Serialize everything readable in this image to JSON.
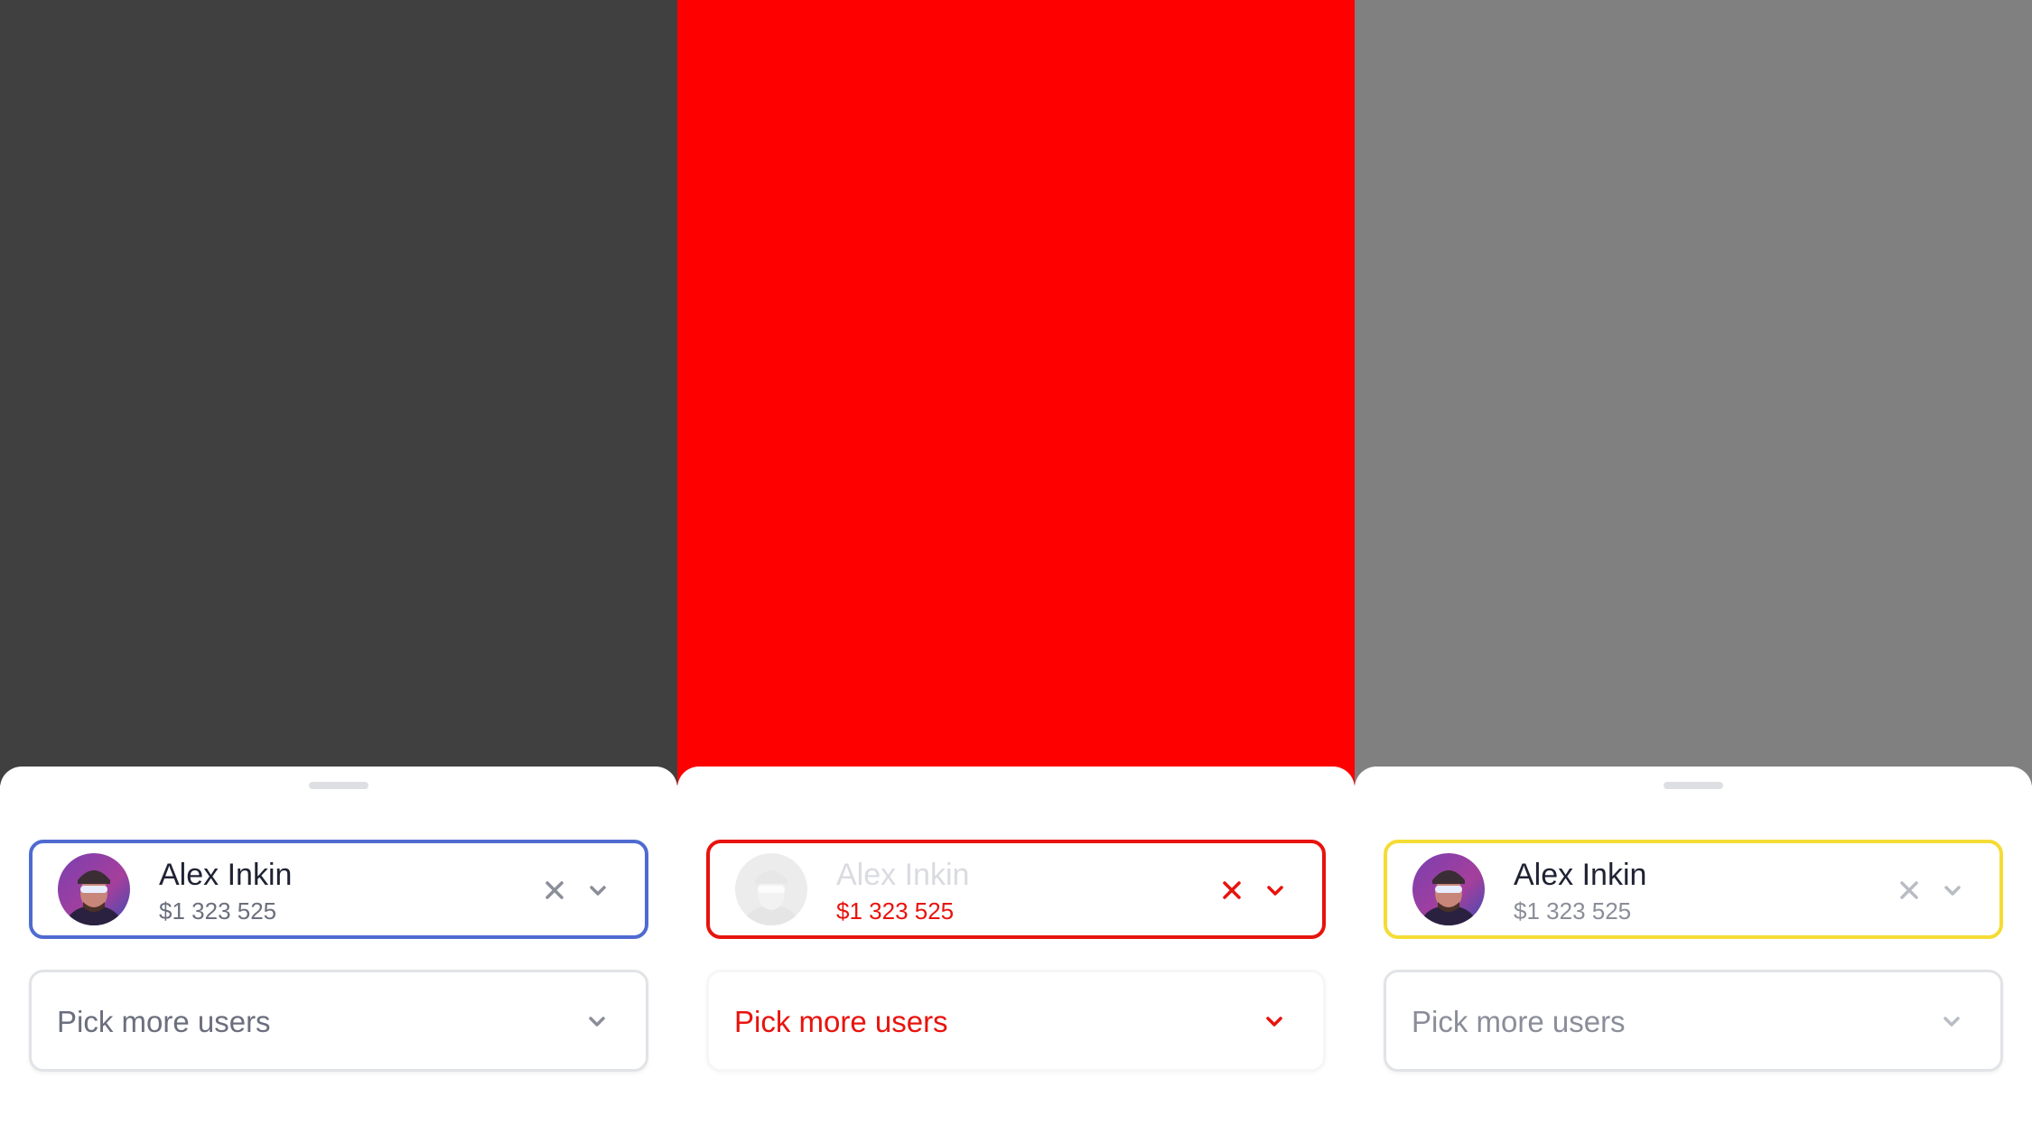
{
  "colors": {
    "backdrop_default": "#404040",
    "backdrop_error": "#ff0000",
    "backdrop_warning": "#808080",
    "focus_border": "#4f6bd1",
    "error": "#e8130d",
    "warning_border": "#f5dc35",
    "icon_gray": "#8a8e99"
  },
  "panels": [
    {
      "state": "default",
      "selected_user": {
        "name": "Alex Inkin",
        "amount": "$1 323 525"
      },
      "clear_icon": "close-icon",
      "expand_icon": "chevron-down-icon",
      "more_field": {
        "label": "Pick more users",
        "icon": "chevron-down-icon"
      }
    },
    {
      "state": "error",
      "selected_user": {
        "name": "Alex Inkin",
        "amount": "$1 323 525"
      },
      "clear_icon": "close-icon",
      "expand_icon": "chevron-down-icon",
      "more_field": {
        "label": "Pick more users",
        "icon": "chevron-down-icon"
      }
    },
    {
      "state": "warning",
      "selected_user": {
        "name": "Alex Inkin",
        "amount": "$1 323 525"
      },
      "clear_icon": "close-icon",
      "expand_icon": "chevron-down-icon",
      "more_field": {
        "label": "Pick more users",
        "icon": "chevron-down-icon"
      }
    }
  ]
}
